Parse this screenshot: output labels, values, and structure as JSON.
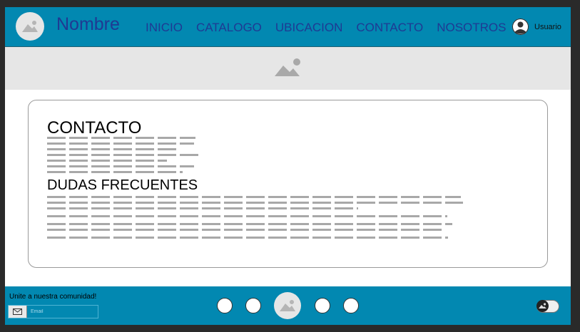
{
  "header": {
    "brand": "Nombre",
    "nav": [
      "INICIO",
      "CATALOGO",
      "UBICACION",
      "CONTACTO",
      "NOSOTROS"
    ],
    "user_label": "Usuario"
  },
  "main": {
    "contact_title": "CONTACTO",
    "faq_title": "DUDAS FRECUENTES"
  },
  "footer": {
    "community_label": "Unite a nuestra comunidad!",
    "email_placeholder": "Email"
  },
  "colors": {
    "header_bg": "#0288b1",
    "brand_text": "#1f3a93",
    "banner_bg": "#e6e6e6",
    "placeholder_lines": "#a8a8a8"
  },
  "icons": [
    "image-placeholder-icon",
    "user-avatar-icon",
    "mail-icon"
  ]
}
